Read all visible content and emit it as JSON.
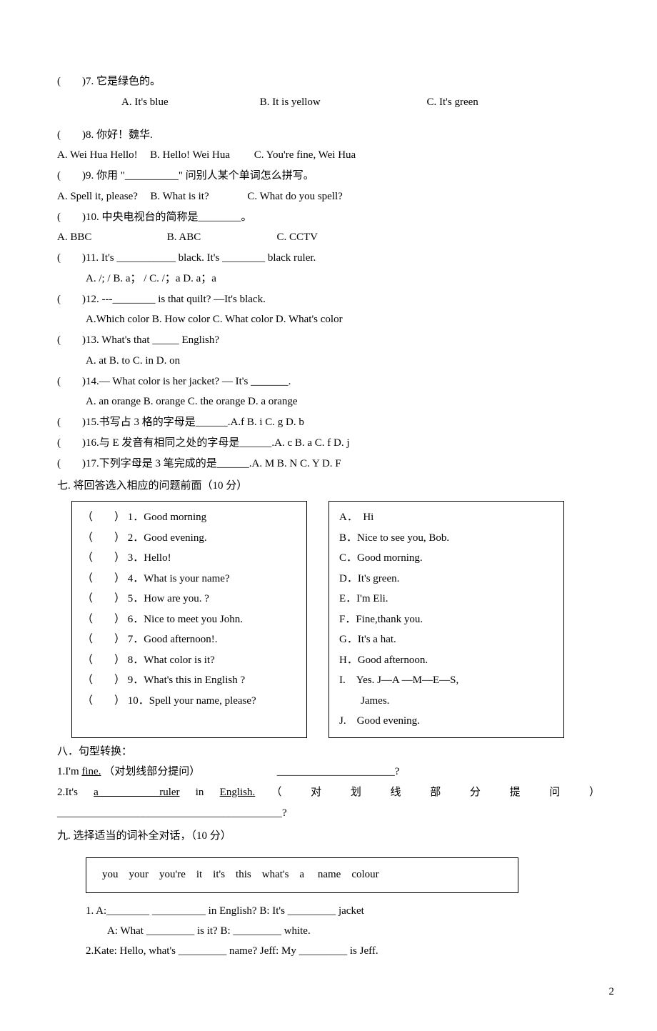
{
  "q7": {
    "stem": "(　　)7. 它是绿色的。",
    "optA": "A. It's blue",
    "optB": "B. It is yellow",
    "optC": "C. It's green"
  },
  "q8": {
    "stem": "(　　)8. 你好！魏华.",
    "optA": "A. Wei Hua Hello!",
    "optB": "B. Hello! Wei Hua",
    "optC": "C. You're fine, Wei Hua"
  },
  "q9": {
    "stem": "(　　)9. 你用 \"__________\" 问别人某个单词怎么拼写。",
    "optA": "A. Spell it, please?",
    "optB": "B. What is it?",
    "optC": "C. What do you spell?"
  },
  "q10": {
    "stem": "(　　)10. 中央电视台的简称是________。",
    "optA": "A. BBC",
    "optB": "B. ABC",
    "optC": "C. CCTV"
  },
  "q11": {
    "stem": "(　　)11. It's ___________ black. It's ________ black ruler.",
    "opts": "A. /; / B. a； / C. /；a D. a；a"
  },
  "q12": {
    "stem": "(　　)12. ---________ is that quilt? —It's black.",
    "opts": "A.Which color B. How color C. What color D. What's  color"
  },
  "q13": {
    "stem": "(　　)13. What's that _____ English?",
    "opts": "A. at B. to C. in  D. on"
  },
  "q14": {
    "stem": "(　　)14.— What color is her jacket? — It's _______.",
    "opts": "A. an orange B. orange C. the orange D. a orange"
  },
  "q15": "(　　)15.书写占 3 格的字母是______.A.f  B. i  C. g  D.  b",
  "q16": "(　　)16.与 E 发音有相同之处的字母是______.A. c  B. a  C. f  D. j",
  "q17": "(　　)17.下列字母是 3 笔完成的是______.A. M  B.  N  C.  Y  D. F",
  "section7": "七. 将回答选入相应的问题前面（10 分）",
  "match": {
    "left": [
      "（　　） 1．Good morning",
      "（　　） 2．Good evening.",
      "（　　） 3．Hello!",
      "（　　） 4．What is your name?",
      "（　　） 5．How are   you. ?",
      "（　　） 6．Nice to meet you John.",
      "（　　） 7．Good afternoon!.",
      "（　　） 8．What color is it?",
      "（　　） 9．What's this in English ?",
      "（　　） 10．Spell your name, please?"
    ],
    "right": [
      "A．　Hi",
      "B．Nice to see you, Bob.",
      "C．Good morning.",
      "D．It's green.",
      "E．I'm Eli.",
      "F．Fine,thank you.",
      "G．It's a hat.",
      "H．Good afternoon.",
      "I.　Yes. J—A —M—E—S,",
      "　　James.",
      "J.　Good evening."
    ]
  },
  "section8": "八．句型转换：",
  "s8q1a": "1.I'm ",
  "s8q1b": "fine.",
  "s8q1c": "（对划线部分提问）",
  "s8q1d": "______________________?",
  "s8q2_words": [
    "2.It's",
    "a　　ruler",
    "in",
    "English.",
    "（",
    "对",
    "划",
    "线",
    "部",
    "分",
    "提",
    "问",
    "）"
  ],
  "s8q2b": "__________________________________________?",
  "section9": "九. 选择适当的词补全对话，（10 分）",
  "word_bank": "you　your　you're　it　it's　this　what's　a　 name　colour",
  "dlg1a": "1. A:________ __________ in English?  B: It's _________ jacket",
  "dlg1b": "A: What _________ is it?   B: _________ white.",
  "dlg2": "2.Kate: Hello, what's _________ name?  Jeff: My _________ is Jeff.",
  "page_number": "2"
}
